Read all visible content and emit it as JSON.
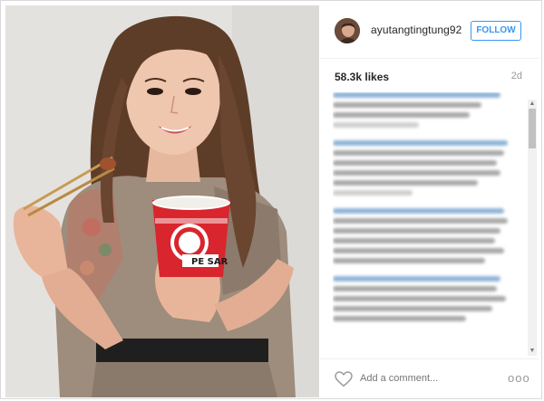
{
  "post": {
    "username": "ayutangtingtung92",
    "follow_label": "FOLLOW",
    "likes": "58.3k likes",
    "time_ago": "2d",
    "comment_placeholder": "Add a comment...",
    "more_label": "ooo"
  },
  "cup": {
    "brand_text": "PE SAR"
  },
  "icons": {
    "heart": "heart-icon",
    "more": "more-options-icon",
    "scroll_up": "scroll-up-arrow-icon",
    "scroll_down": "scroll-down-arrow-icon"
  },
  "colors": {
    "follow_blue": "#3897f0",
    "cup_red": "#d9252d",
    "comment_link_blue": "#8fb4d8"
  }
}
